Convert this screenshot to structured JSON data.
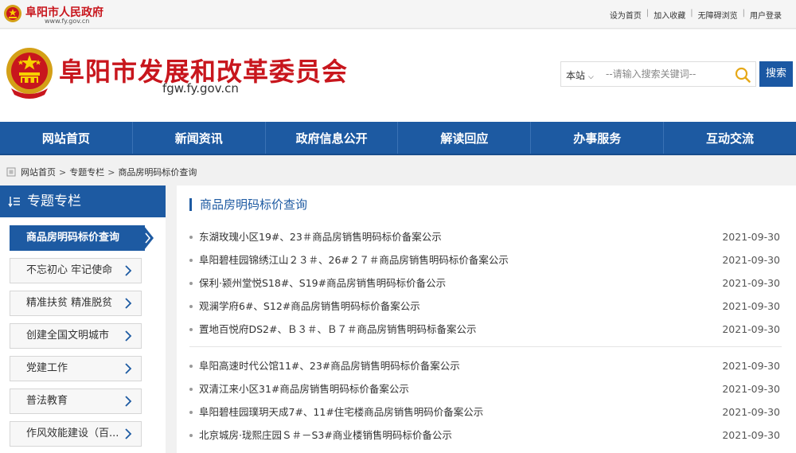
{
  "topbar": {
    "gov_name": "阜阳市人民政府",
    "gov_url": "www.fy.gov.cn",
    "links": [
      "设为首页",
      "加入收藏",
      "无障碍浏览",
      "用户登录"
    ]
  },
  "header": {
    "site_title": "阜阳市发展和改革委员会",
    "site_url": "fgw.fy.gov.cn",
    "search_scope": "本站",
    "search_placeholder": "--请输入搜索关键词--",
    "search_button": "搜索"
  },
  "nav": [
    "网站首页",
    "新闻资讯",
    "政府信息公开",
    "解读回应",
    "办事服务",
    "互动交流"
  ],
  "breadcrumb": [
    "网站首页",
    "专题专栏",
    "商品房明码标价查询"
  ],
  "sidebar": {
    "title": "专题专栏",
    "items": [
      {
        "label": "商品房明码标价查询",
        "active": true
      },
      {
        "label": "不忘初心 牢记使命",
        "active": false
      },
      {
        "label": "精准扶贫 精准脱贫",
        "active": false
      },
      {
        "label": "创建全国文明城市",
        "active": false
      },
      {
        "label": "党建工作",
        "active": false
      },
      {
        "label": "普法教育",
        "active": false
      },
      {
        "label": "作风效能建设（百...",
        "active": false
      }
    ]
  },
  "main": {
    "title": "商品房明码标价查询",
    "group1": [
      {
        "title": "东湖玫瑰小区19#、23＃商品房销售明码标价备案公示",
        "date": "2021-09-30"
      },
      {
        "title": "阜阳碧桂园锦绣江山２３＃、26#２７＃商品房销售明码标价备案公示",
        "date": "2021-09-30"
      },
      {
        "title": "保利·颍州堂悦S18#、S19#商品房销售明码标价备公示",
        "date": "2021-09-30"
      },
      {
        "title": "观澜学府6#、S12#商品房销售明码标价备案公示",
        "date": "2021-09-30"
      },
      {
        "title": "置地百悦府DS2#、Ｂ３＃、Ｂ７＃商品房销售明码标备案公示",
        "date": "2021-09-30"
      }
    ],
    "group2": [
      {
        "title": "阜阳高速时代公馆11#、23#商品房销售明码标价备案公示",
        "date": "2021-09-30"
      },
      {
        "title": "双清江来小区31#商品房销售明码标价备案公示",
        "date": "2021-09-30"
      },
      {
        "title": "阜阳碧桂园璞玥天成7#、11#住宅楼商品房销售明码价备案公示",
        "date": "2021-09-30"
      },
      {
        "title": "北京城房·珑熙庄园Ｓ＃－S3#商业楼销售明码标价备公示",
        "date": "2021-09-30"
      }
    ]
  },
  "colors": {
    "brand_red": "#c8161d",
    "nav_blue": "#1d5aa2"
  }
}
